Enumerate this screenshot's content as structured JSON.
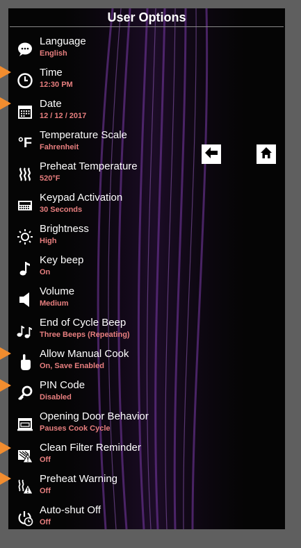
{
  "header": {
    "title": "User Options"
  },
  "options": [
    {
      "label": "Language",
      "value": "English",
      "icon": "speech-bubble-icon"
    },
    {
      "label": "Time",
      "value": "12:30 PM",
      "icon": "clock-icon"
    },
    {
      "label": "Date",
      "value": "12 / 12 / 2017",
      "icon": "calendar-icon"
    },
    {
      "label": "Temperature Scale",
      "value": "Fahrenheit",
      "icon": "degree-fahrenheit-icon",
      "icon_text": "°F"
    },
    {
      "label": "Preheat Temperature",
      "value": "520°F",
      "icon": "heat-waves-icon"
    },
    {
      "label": "Keypad Activation",
      "value": "30 Seconds",
      "icon": "keypad-icon"
    },
    {
      "label": "Brightness",
      "value": "High",
      "icon": "sun-icon"
    },
    {
      "label": "Key beep",
      "value": "On",
      "icon": "music-note-icon"
    },
    {
      "label": "Volume",
      "value": "Medium",
      "icon": "speaker-icon"
    },
    {
      "label": "End of Cycle Beep",
      "value": "Three Beeps (Repeating)",
      "icon": "double-music-note-icon"
    },
    {
      "label": "Allow Manual Cook",
      "value": "On, Save Enabled",
      "icon": "pointing-hand-icon"
    },
    {
      "label": "PIN Code",
      "value": "Disabled",
      "icon": "key-icon"
    },
    {
      "label": "Opening Door Behavior",
      "value": "Pauses Cook Cycle",
      "icon": "oven-door-icon"
    },
    {
      "label": "Clean Filter Reminder",
      "value": "Off",
      "icon": "filter-warning-icon"
    },
    {
      "label": "Preheat Warning",
      "value": "Off",
      "icon": "heat-warning-icon"
    },
    {
      "label": "Auto-shut Off",
      "value": "Off",
      "icon": "power-timer-icon"
    }
  ],
  "nav": {
    "back_icon": "back-arrow-icon",
    "home_icon": "home-icon"
  },
  "colors": {
    "value_text": "#e87f7f",
    "marker": "#f28d2f",
    "frame": "#5f5f5f",
    "background": "#050505"
  }
}
